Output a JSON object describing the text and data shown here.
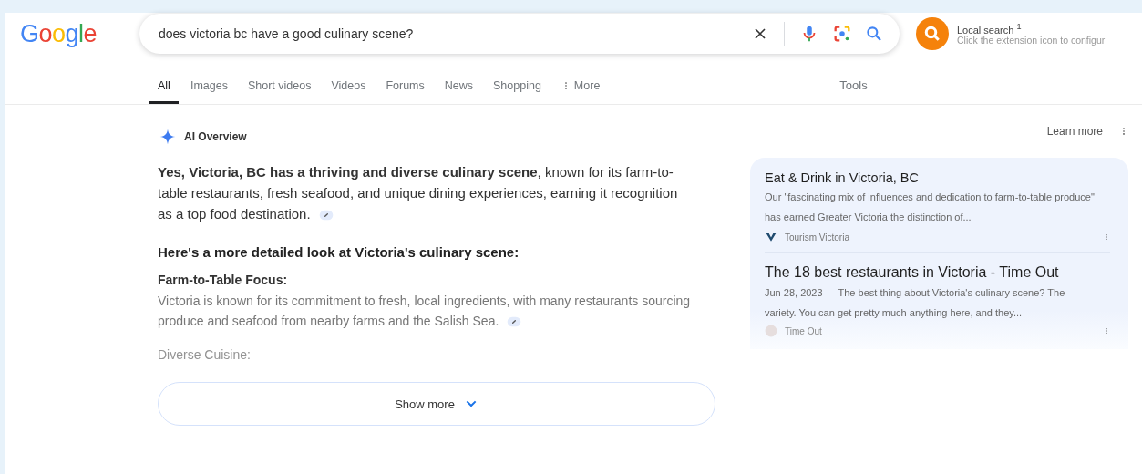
{
  "logo": "Google",
  "search": {
    "value": "does victoria bc have a good culinary scene?"
  },
  "extension": {
    "title": "Local search",
    "note": "1",
    "subtitle": "Click the extension icon to configur"
  },
  "tabs": [
    {
      "label": "All",
      "selected": true
    },
    {
      "label": "Images",
      "selected": false
    },
    {
      "label": "Short videos",
      "selected": false
    },
    {
      "label": "Videos",
      "selected": false
    },
    {
      "label": "Forums",
      "selected": false
    },
    {
      "label": "News",
      "selected": false
    },
    {
      "label": "Shopping",
      "selected": false
    },
    {
      "label": "More",
      "selected": false,
      "kind": "menu"
    }
  ],
  "tools": "Tools",
  "ai_overview": {
    "title": "AI Overview",
    "learn_more": "Learn more",
    "answer": "**Yes, Victoria, BC has a thriving and diverse culinary scene**, known for its farm-to-table restaurants, fresh seafood, and unique dining experiences, earning it recognition as a top food destination.",
    "subheading": "Here's a more detailed look at Victoria's culinary scene:",
    "sections": [
      {
        "heading": "Farm-to-Table Focus:",
        "text": "Victoria is known for its commitment to fresh, local ingredients, with many restaurants sourcing produce and seafood from nearby farms and the Salish Sea."
      },
      {
        "heading": "Diverse Cuisine:"
      }
    ],
    "show_more": "Show more",
    "sources": [
      {
        "title": "Eat & Drink in Victoria, BC",
        "snippet": "Our \"fascinating mix of influences and dedication to farm-to-table produce\" has earned Greater Victoria the distinction of...",
        "site": "Tourism Victoria"
      },
      {
        "title": "The 18 best restaurants in Victoria - Time Out",
        "snippet": "Jun 28, 2023 — The best thing about Victoria's culinary scene? The variety. You can get pretty much anything here, and they...",
        "site": "Time Out"
      }
    ]
  }
}
